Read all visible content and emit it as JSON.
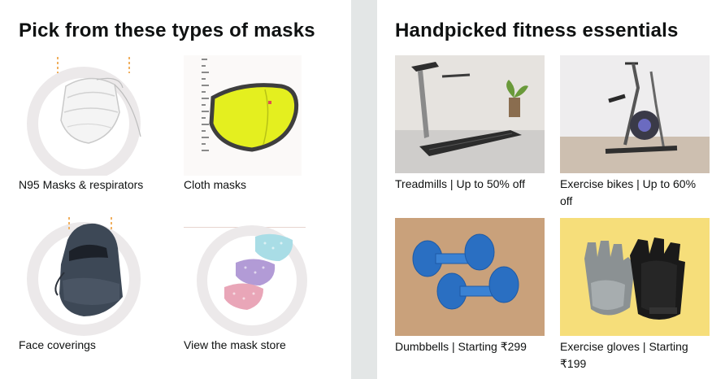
{
  "masks_card": {
    "title": "Pick from these types of masks",
    "items": [
      {
        "label": "N95 Masks & respirators",
        "icon": "n95-mask-image"
      },
      {
        "label": "Cloth masks",
        "icon": "cloth-mask-image"
      },
      {
        "label": "Face coverings",
        "icon": "face-covering-image"
      },
      {
        "label": "View the mask store",
        "icon": "mask-store-image"
      }
    ]
  },
  "fitness_card": {
    "title": "Handpicked fitness essentials",
    "items": [
      {
        "label": "Treadmills | Up to 50% off",
        "icon": "treadmill-image"
      },
      {
        "label": "Exercise bikes | Up to 60% off",
        "icon": "exercise-bike-image"
      },
      {
        "label": "Dumbbells | Starting ₹299",
        "icon": "dumbbells-image"
      },
      {
        "label": "Exercise gloves | Starting ₹199",
        "icon": "exercise-gloves-image"
      }
    ]
  },
  "colors": {
    "page_bg": "#e3e6e6",
    "card_bg": "#ffffff",
    "text": "#0f1111",
    "mask_yellow": "#e4ef1f",
    "dumbbell_blue": "#2a6fc2"
  }
}
